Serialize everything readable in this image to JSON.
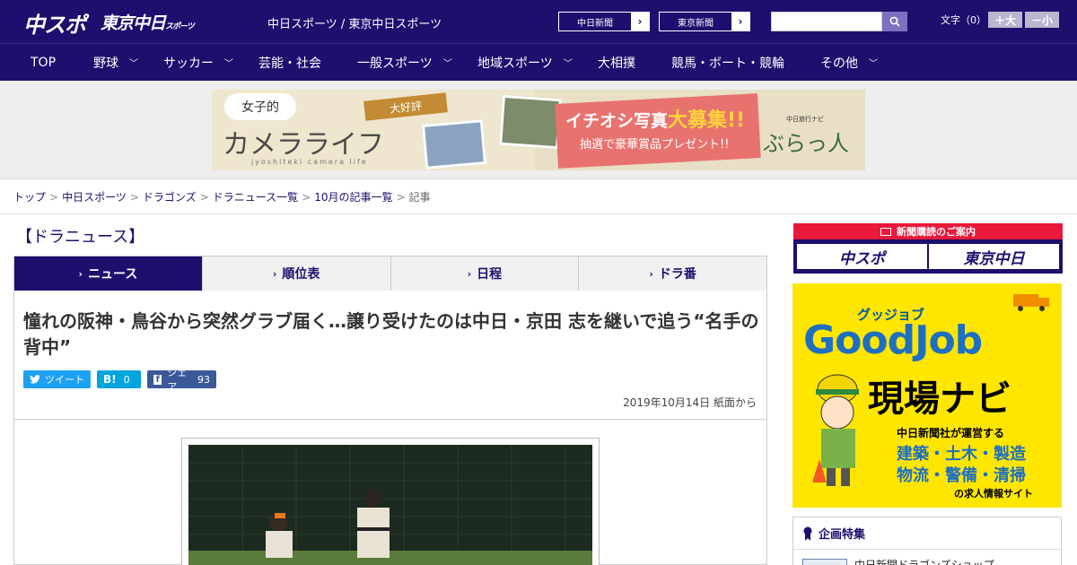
{
  "header": {
    "logo_chuspo": "中スポ",
    "logo_tokyo": "東京中日",
    "logo_tokyo_suffix": "スポーツ",
    "site_names": "中日スポーツ / 東京中日スポーツ",
    "paper_buttons": [
      "中日新聞",
      "東京新聞"
    ],
    "search_placeholder": "",
    "fontsize_label": "文字（0）",
    "font_plus": "＋大",
    "font_minus": "－小"
  },
  "nav": {
    "items": [
      {
        "label": "TOP",
        "dropdown": false
      },
      {
        "label": "野球",
        "dropdown": true
      },
      {
        "label": "サッカー",
        "dropdown": true
      },
      {
        "label": "芸能・社会",
        "dropdown": false
      },
      {
        "label": "一般スポーツ",
        "dropdown": true
      },
      {
        "label": "地域スポーツ",
        "dropdown": true
      },
      {
        "label": "大相撲",
        "dropdown": false
      },
      {
        "label": "競馬・ボート・競輪",
        "dropdown": false
      },
      {
        "label": "その他",
        "dropdown": true
      }
    ]
  },
  "banner": {
    "jyoshi": "女子的",
    "camera_life": "カメラライフ",
    "sub": "jyoshiteki camera life",
    "daikohyo": "大好評",
    "title_pre": "イチオシ写真",
    "title_em": "大募集!!",
    "subline": "抽選で豪華賞品プレゼント!!",
    "brand_small": "中日旅行ナビ",
    "brand": "ぶらっ人"
  },
  "breadcrumb": [
    "トップ",
    "中日スポーツ",
    "ドラゴンズ",
    "ドラニュース一覧",
    "10月の記事一覧",
    "記事"
  ],
  "section_title": "【ドラニュース】",
  "tabs": [
    {
      "label": "ニュース",
      "active": true
    },
    {
      "label": "順位表",
      "active": false
    },
    {
      "label": "日程",
      "active": false
    },
    {
      "label": "ドラ番",
      "active": false
    }
  ],
  "article": {
    "headline": "憧れの阪神・鳥谷から突然グラブ届く…譲り受けたのは中日・京田 志を継いで追う“名手の背中”",
    "share": {
      "tweet": "ツイート",
      "hatena": "B!",
      "hatena_count": "0",
      "facebook": "シェア",
      "facebook_count": "93"
    },
    "date": "2019年10月14日 紙面から"
  },
  "sidebar": {
    "subscribe_title": "新聞購読のご案内",
    "subscribe_buttons": [
      "中スポ",
      "東京中日"
    ],
    "goodjob": {
      "small": "グッジョブ",
      "title": "GoodJob",
      "navi": "現場ナビ",
      "desc1": "中日新聞社が運営する",
      "desc2": "建築・土木・製造",
      "desc3": "物流・警備・清掃",
      "desc4": "の求人情報サイト"
    },
    "tokushu_title": "企画特集",
    "tokushu_item": "中日新聞ドラゴンズショップ"
  },
  "colors": {
    "brand_navy": "#1d0f6e",
    "accent_red": "#e8193b",
    "goodjob_yellow": "#ffe600",
    "twitter": "#1da1f2",
    "hatena": "#00a4de",
    "facebook": "#3b5998"
  }
}
